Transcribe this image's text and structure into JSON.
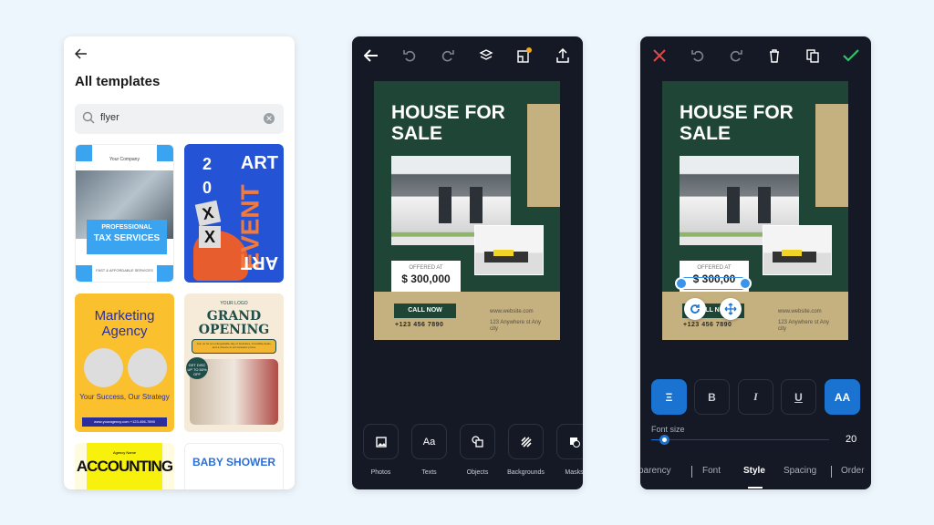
{
  "templates_screen": {
    "back_icon": "arrow-left",
    "title": "All templates",
    "search": {
      "value": "flyer",
      "icon": "search-icon",
      "clear_icon": "clear-icon"
    },
    "templates": [
      {
        "name": "tax-services",
        "company": "Your Company",
        "line1": "PROFESSIONAL",
        "line2": "TAX SERVICES",
        "footer": "FAST & AFFORDABLE SERVICES"
      },
      {
        "name": "art-event",
        "year": [
          "2",
          "0",
          "X",
          "X"
        ],
        "art_top": "ART",
        "event": "EVENT",
        "art_bottom": "ART"
      },
      {
        "name": "marketing-agency",
        "heading": "Marketing Agency",
        "slogan": "Your Success, Our Strategy",
        "footer": "www.youragency.com   +123-456-7890"
      },
      {
        "name": "grand-opening",
        "logo": "YOUR LOGO",
        "heading": "GRAND OPENING",
        "promo": "Join us for an unforgettable day of festivities, incredible deals, and a chance to win fantastic prizes",
        "badge": "GET DISC UP TO 50% OFF"
      },
      {
        "name": "accounting-service",
        "agency": "Agency Name",
        "heading": "ACCOUNTING"
      },
      {
        "name": "baby-shower",
        "heading": "BABY SHOWER"
      }
    ]
  },
  "editor_screen": {
    "toolbar": [
      "back",
      "undo",
      "redo",
      "layers",
      "resize-premium",
      "export"
    ],
    "flyer": {
      "headline": "HOUSE FOR SALE",
      "offered_label": "OFFERED AT",
      "price": "$ 300,000",
      "cta": "CALL NOW",
      "phone": "+123 456 7890",
      "website": "www.website.com",
      "address": "123 Anywhere st Any city"
    },
    "tools": [
      {
        "label": "Photos",
        "icon": "photo-icon"
      },
      {
        "label": "Texts",
        "icon": "text-icon",
        "glyph": "Aa"
      },
      {
        "label": "Objects",
        "icon": "shapes-icon"
      },
      {
        "label": "Backgrounds",
        "icon": "backgrounds-icon"
      },
      {
        "label": "Masks",
        "icon": "mask-icon"
      }
    ]
  },
  "text_edit_screen": {
    "toolbar": [
      "cancel",
      "undo",
      "redo",
      "delete",
      "duplicate",
      "confirm"
    ],
    "selected_price": "$ 300,00",
    "format_buttons": [
      {
        "label": "Ξ",
        "name": "align",
        "active": true
      },
      {
        "label": "B",
        "name": "bold",
        "active": false
      },
      {
        "label": "I",
        "name": "italic",
        "active": false
      },
      {
        "label": "U",
        "name": "underline",
        "active": false
      },
      {
        "label": "AA",
        "name": "uppercase",
        "active": true
      }
    ],
    "font_size_label": "Font size",
    "font_size_value": "20",
    "font_size_fraction": 0.07,
    "tabs": [
      "parency",
      "Font",
      "Style",
      "Spacing",
      "Order"
    ],
    "active_tab": "Style"
  },
  "colors": {
    "background": "#eef6fd",
    "editor_bg": "#141925",
    "flyer_green": "#1e4536",
    "flyer_tan": "#c4b17f",
    "accent_blue": "#1a73d1",
    "cancel_red": "#e04848",
    "confirm_green": "#2ec46b",
    "premium_gold": "#f0a91e"
  }
}
